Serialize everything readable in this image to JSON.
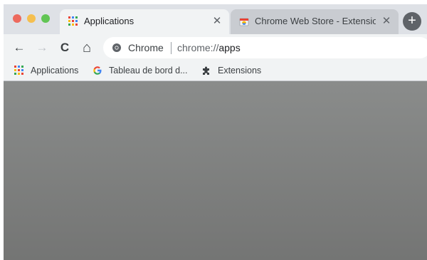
{
  "window": {
    "traffic_lights": [
      "close",
      "minimize",
      "zoom"
    ]
  },
  "tabs": [
    {
      "title": "Applications",
      "icon": "apps-grid-icon",
      "active": true
    },
    {
      "title": "Chrome Web Store - Extensions",
      "icon": "chrome-web-store-icon",
      "active": false
    }
  ],
  "toolbar": {
    "back": "←",
    "forward": "→",
    "reload": "C",
    "home": "⌂",
    "omnibox": {
      "chip": "Chrome",
      "url_prefix": "chrome://",
      "url_host": "apps"
    }
  },
  "bookmarks": [
    {
      "label": "Applications",
      "icon": "apps-grid-icon"
    },
    {
      "label": "Tableau de bord d...",
      "icon": "google-g-icon"
    },
    {
      "label": "Extensions",
      "icon": "puzzle-icon"
    }
  ],
  "colors": {
    "tabstrip": "#dee1e6",
    "toolbar": "#f1f3f4",
    "content_top": "#8a8c8b",
    "content_bottom": "#747574"
  }
}
